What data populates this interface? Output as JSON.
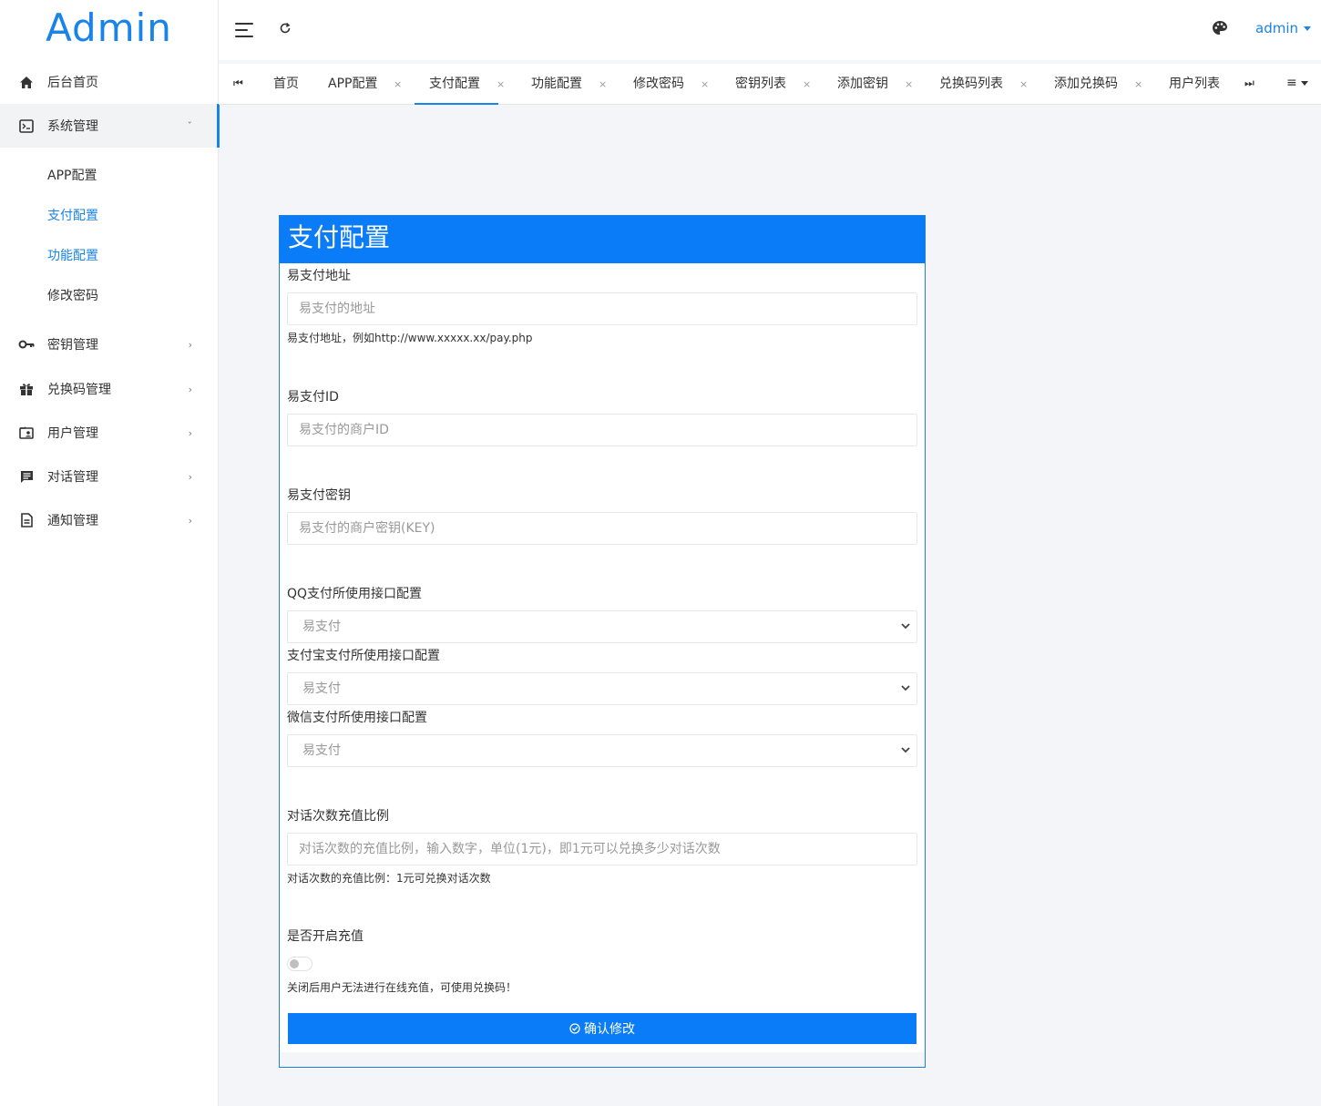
{
  "sidebar": {
    "logo": "Admin",
    "items": [
      {
        "label": "后台首页",
        "icon": "home-icon"
      },
      {
        "label": "系统管理",
        "icon": "terminal-icon",
        "chevron": "ˇ"
      },
      {
        "label": "密钥管理",
        "icon": "key-icon",
        "chevron": "›"
      },
      {
        "label": "兑换码管理",
        "icon": "gift-icon",
        "chevron": "›"
      },
      {
        "label": "用户管理",
        "icon": "user-card-icon",
        "chevron": "›"
      },
      {
        "label": "对话管理",
        "icon": "chat-icon",
        "chevron": "›"
      },
      {
        "label": "通知管理",
        "icon": "document-icon",
        "chevron": "›"
      }
    ],
    "sub_items": [
      "APP配置",
      "支付配置",
      "功能配置",
      "修改密码"
    ]
  },
  "header": {
    "user": "admin"
  },
  "tabs": {
    "first_btn": "⏮",
    "last_btn": "⏭",
    "menu": "≡",
    "items": [
      {
        "label": "首页",
        "close": ""
      },
      {
        "label": "APP配置",
        "close": "×"
      },
      {
        "label": "支付配置",
        "close": "×"
      },
      {
        "label": "功能配置",
        "close": "×"
      },
      {
        "label": "修改密码",
        "close": "×"
      },
      {
        "label": "密钥列表",
        "close": "×"
      },
      {
        "label": "添加密钥",
        "close": "×"
      },
      {
        "label": "兑换码列表",
        "close": "×"
      },
      {
        "label": "添加兑换码",
        "close": "×"
      },
      {
        "label": "用户列表",
        "close": ""
      }
    ]
  },
  "form": {
    "title": "支付配置",
    "pay_url": {
      "label": "易支付地址",
      "placeholder": "易支付的地址",
      "help": "易支付地址，例如http://www.xxxxx.xx/pay.php"
    },
    "pay_id": {
      "label": "易支付ID",
      "placeholder": "易支付的商户ID"
    },
    "pay_key": {
      "label": "易支付密钥",
      "placeholder": "易支付的商户密钥(KEY)"
    },
    "qq_pay": {
      "label": "QQ支付所使用接口配置",
      "value": "易支付"
    },
    "alipay": {
      "label": "支付宝支付所使用接口配置",
      "value": "易支付"
    },
    "wechat_pay": {
      "label": "微信支付所使用接口配置",
      "value": "易支付"
    },
    "ratio": {
      "label": "对话次数充值比例",
      "placeholder": "对话次数的充值比例，输入数字，单位(1元)，即1元可以兑换多少对话次数",
      "help": "对话次数的充值比例：1元可兑换对话次数"
    },
    "recharge": {
      "label": "是否开启充值",
      "enabled": false,
      "help": "关闭后用户无法进行在线充值，可使用兑换码！"
    },
    "submit": "确认修改"
  },
  "colors": {
    "accent": "#1883e8",
    "primary_button": "#0a7cf7"
  }
}
